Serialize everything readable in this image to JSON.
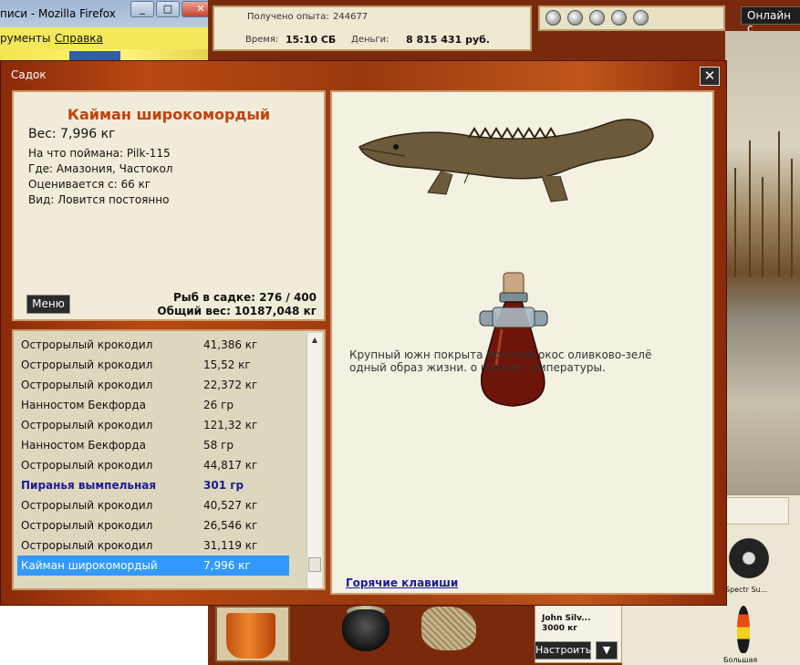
{
  "browser": {
    "title": "писи - Mozilla Firefox",
    "menu": [
      "рументы",
      "Справка"
    ],
    "window_buttons": [
      "_",
      "□",
      "✕"
    ]
  },
  "game": {
    "exp_label": "Получено опыта:",
    "exp_value": "244677",
    "time_label": "Время:",
    "time_value": "15:10 СБ",
    "money_label": "Деньги:",
    "money_value": "8 815 431 руб.",
    "online_label": "Онлайн с"
  },
  "sadok": {
    "title": "Садок",
    "close_label": "✕",
    "fish": {
      "name": "Кайман широкомордый",
      "weight_line": "Вес: 7,996 кг",
      "bait_line": "На что поймана: Pilk-115",
      "where_line": "Где: Амазония, Частокол",
      "value_line": "Оценивается с: 66 кг",
      "kind_line": "Вид: Ловится постоянно"
    },
    "menu_button": "Меню",
    "count_line": "Рыб в садке: 276 / 400",
    "total_weight_line": "Общий вес: 10187,048 кг",
    "list": [
      {
        "name": "Острорылый крокодил",
        "weight": "41,386 кг"
      },
      {
        "name": "Острорылый крокодил",
        "weight": "15,52 кг"
      },
      {
        "name": "Острорылый крокодил",
        "weight": "22,372 кг"
      },
      {
        "name": "Нанностом Бекфорда",
        "weight": "26 гр"
      },
      {
        "name": "Острорылый крокодил",
        "weight": "121,32 кг"
      },
      {
        "name": "Нанностом Бекфорда",
        "weight": "58 гр"
      },
      {
        "name": "Острорылый крокодил",
        "weight": "44,817 кг"
      },
      {
        "name": "Пиранья вымпельная",
        "weight": "301 гр"
      },
      {
        "name": "Острорылый крокодил",
        "weight": "40,527 кг"
      },
      {
        "name": "Острорылый крокодил",
        "weight": "26,546 кг"
      },
      {
        "name": "Острорылый крокодил",
        "weight": "31,119 кг"
      },
      {
        "name": "Кайман широкомордый",
        "weight": "7,996 кг"
      }
    ],
    "description": "Крупный южн                        покрыта прочной окос оливково-зелё                        одный образ жизни.                        о низкие температуры.",
    "hotkeys_link": "Горячие клавиши"
  },
  "tackle": {
    "name": "John Silv...",
    "weight": "3000 кг",
    "setup_button": "Настроить",
    "dropdown_label": "▼",
    "line_label": "Spectr Su...",
    "float_label": "Большая"
  },
  "colors": {
    "frame": "#b94912",
    "fish_name": "#c2410b",
    "highlight_row": "#1c1c92",
    "selected_row": "#3399ff",
    "hotkeys": "#1a1a9e"
  }
}
